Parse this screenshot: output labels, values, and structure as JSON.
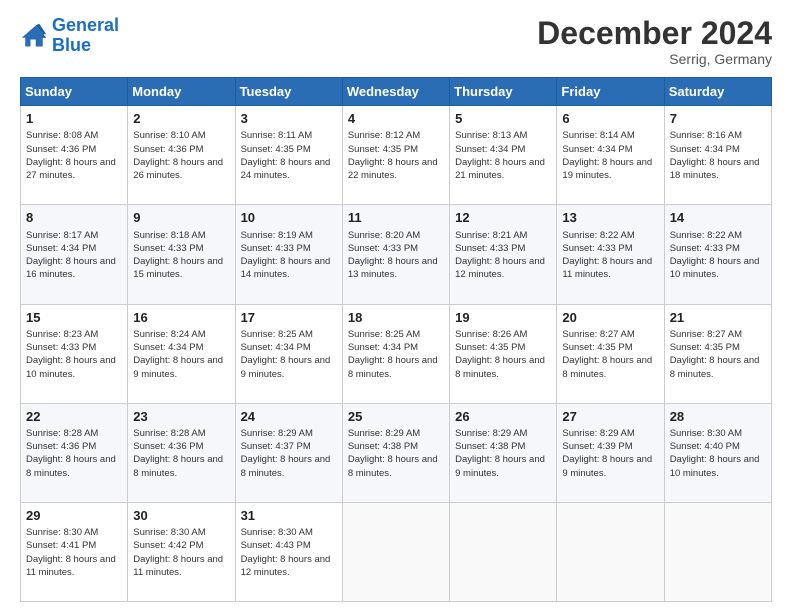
{
  "logo": {
    "line1": "General",
    "line2": "Blue"
  },
  "title": "December 2024",
  "subtitle": "Serrig, Germany",
  "days_of_week": [
    "Sunday",
    "Monday",
    "Tuesday",
    "Wednesday",
    "Thursday",
    "Friday",
    "Saturday"
  ],
  "weeks": [
    [
      {
        "day": 1,
        "sunrise": "8:08 AM",
        "sunset": "4:36 PM",
        "daylight": "8 hours and 27 minutes."
      },
      {
        "day": 2,
        "sunrise": "8:10 AM",
        "sunset": "4:36 PM",
        "daylight": "8 hours and 26 minutes."
      },
      {
        "day": 3,
        "sunrise": "8:11 AM",
        "sunset": "4:35 PM",
        "daylight": "8 hours and 24 minutes."
      },
      {
        "day": 4,
        "sunrise": "8:12 AM",
        "sunset": "4:35 PM",
        "daylight": "8 hours and 22 minutes."
      },
      {
        "day": 5,
        "sunrise": "8:13 AM",
        "sunset": "4:34 PM",
        "daylight": "8 hours and 21 minutes."
      },
      {
        "day": 6,
        "sunrise": "8:14 AM",
        "sunset": "4:34 PM",
        "daylight": "8 hours and 19 minutes."
      },
      {
        "day": 7,
        "sunrise": "8:16 AM",
        "sunset": "4:34 PM",
        "daylight": "8 hours and 18 minutes."
      }
    ],
    [
      {
        "day": 8,
        "sunrise": "8:17 AM",
        "sunset": "4:34 PM",
        "daylight": "8 hours and 16 minutes."
      },
      {
        "day": 9,
        "sunrise": "8:18 AM",
        "sunset": "4:33 PM",
        "daylight": "8 hours and 15 minutes."
      },
      {
        "day": 10,
        "sunrise": "8:19 AM",
        "sunset": "4:33 PM",
        "daylight": "8 hours and 14 minutes."
      },
      {
        "day": 11,
        "sunrise": "8:20 AM",
        "sunset": "4:33 PM",
        "daylight": "8 hours and 13 minutes."
      },
      {
        "day": 12,
        "sunrise": "8:21 AM",
        "sunset": "4:33 PM",
        "daylight": "8 hours and 12 minutes."
      },
      {
        "day": 13,
        "sunrise": "8:22 AM",
        "sunset": "4:33 PM",
        "daylight": "8 hours and 11 minutes."
      },
      {
        "day": 14,
        "sunrise": "8:22 AM",
        "sunset": "4:33 PM",
        "daylight": "8 hours and 10 minutes."
      }
    ],
    [
      {
        "day": 15,
        "sunrise": "8:23 AM",
        "sunset": "4:33 PM",
        "daylight": "8 hours and 10 minutes."
      },
      {
        "day": 16,
        "sunrise": "8:24 AM",
        "sunset": "4:34 PM",
        "daylight": "8 hours and 9 minutes."
      },
      {
        "day": 17,
        "sunrise": "8:25 AM",
        "sunset": "4:34 PM",
        "daylight": "8 hours and 9 minutes."
      },
      {
        "day": 18,
        "sunrise": "8:25 AM",
        "sunset": "4:34 PM",
        "daylight": "8 hours and 8 minutes."
      },
      {
        "day": 19,
        "sunrise": "8:26 AM",
        "sunset": "4:35 PM",
        "daylight": "8 hours and 8 minutes."
      },
      {
        "day": 20,
        "sunrise": "8:27 AM",
        "sunset": "4:35 PM",
        "daylight": "8 hours and 8 minutes."
      },
      {
        "day": 21,
        "sunrise": "8:27 AM",
        "sunset": "4:35 PM",
        "daylight": "8 hours and 8 minutes."
      }
    ],
    [
      {
        "day": 22,
        "sunrise": "8:28 AM",
        "sunset": "4:36 PM",
        "daylight": "8 hours and 8 minutes."
      },
      {
        "day": 23,
        "sunrise": "8:28 AM",
        "sunset": "4:36 PM",
        "daylight": "8 hours and 8 minutes."
      },
      {
        "day": 24,
        "sunrise": "8:29 AM",
        "sunset": "4:37 PM",
        "daylight": "8 hours and 8 minutes."
      },
      {
        "day": 25,
        "sunrise": "8:29 AM",
        "sunset": "4:38 PM",
        "daylight": "8 hours and 8 minutes."
      },
      {
        "day": 26,
        "sunrise": "8:29 AM",
        "sunset": "4:38 PM",
        "daylight": "8 hours and 9 minutes."
      },
      {
        "day": 27,
        "sunrise": "8:29 AM",
        "sunset": "4:39 PM",
        "daylight": "8 hours and 9 minutes."
      },
      {
        "day": 28,
        "sunrise": "8:30 AM",
        "sunset": "4:40 PM",
        "daylight": "8 hours and 10 minutes."
      }
    ],
    [
      {
        "day": 29,
        "sunrise": "8:30 AM",
        "sunset": "4:41 PM",
        "daylight": "8 hours and 11 minutes."
      },
      {
        "day": 30,
        "sunrise": "8:30 AM",
        "sunset": "4:42 PM",
        "daylight": "8 hours and 11 minutes."
      },
      {
        "day": 31,
        "sunrise": "8:30 AM",
        "sunset": "4:43 PM",
        "daylight": "8 hours and 12 minutes."
      },
      null,
      null,
      null,
      null
    ]
  ]
}
